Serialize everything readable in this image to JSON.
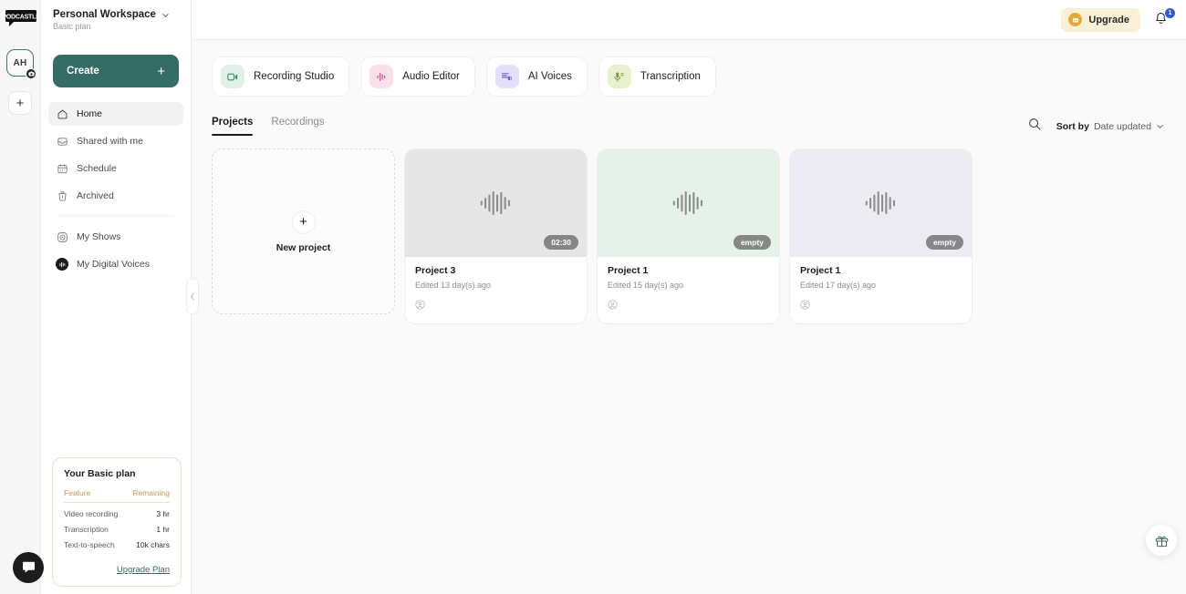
{
  "brand": {
    "logo_text": "PODCASTLE"
  },
  "rail": {
    "avatar_initials": "AH",
    "add_label": "+"
  },
  "workspace": {
    "name": "Personal Workspace",
    "plan": "Basic plan"
  },
  "sidebar": {
    "create_label": "Create",
    "create_plus": "+",
    "items": [
      {
        "label": "Home",
        "icon": "home-icon"
      },
      {
        "label": "Shared with me",
        "icon": "inbox-icon"
      },
      {
        "label": "Schedule",
        "icon": "calendar-icon"
      },
      {
        "label": "Archived",
        "icon": "trash-icon"
      }
    ],
    "secondary_items": [
      {
        "label": "My Shows",
        "icon": "shows-icon"
      },
      {
        "label": "My Digital Voices",
        "icon": "digital-voices-icon"
      }
    ],
    "collapse_icon": "chevron-left-icon"
  },
  "plan_card": {
    "title": "Your Basic plan",
    "col_feature": "Feature",
    "col_remaining": "Remaining",
    "rows": [
      {
        "feature": "Video recording",
        "remaining": "3 hr"
      },
      {
        "feature": "Transcription",
        "remaining": "1 hr"
      },
      {
        "feature": "Text-to-speech",
        "remaining": "10k chars"
      }
    ],
    "upgrade_link": "Upgrade Plan",
    "accent": "#356d64",
    "border": "#e9dfcd",
    "header_color": "#c69a55"
  },
  "topbar": {
    "upgrade_label": "Upgrade",
    "notification_count": "1",
    "badge_color": "#2f5bd8",
    "upgrade_bg": "#faf0d8"
  },
  "features": [
    {
      "label": "Recording Studio",
      "icon": "video-camera-icon",
      "tile_bg": "#dff0e6",
      "glyph": "#3f8f6b"
    },
    {
      "label": "Audio Editor",
      "icon": "audio-waveform-icon",
      "tile_bg": "#f9dfe9",
      "glyph": "#c45d8b"
    },
    {
      "label": "AI Voices",
      "icon": "ai-voices-icon",
      "tile_bg": "#e3e0f9",
      "glyph": "#6b5cc4"
    },
    {
      "label": "Transcription",
      "icon": "microphone-icon",
      "tile_bg": "#e7f0cf",
      "glyph": "#7a9540"
    }
  ],
  "tabs": [
    {
      "label": "Projects",
      "active": true
    },
    {
      "label": "Recordings",
      "active": false
    }
  ],
  "toolbar": {
    "search_icon": "search-icon",
    "sort_prefix": "Sort by",
    "sort_value": "Date updated",
    "chevron": "chevron-down-icon"
  },
  "new_project": {
    "label": "New project",
    "plus": "+"
  },
  "projects": [
    {
      "title": "Project 3",
      "edited": "Edited 13 day(s) ago",
      "badge": "02:30",
      "thumb_bg": "#e6e6e6",
      "wave": "#8d8d8d"
    },
    {
      "title": "Project 1",
      "edited": "Edited 15 day(s) ago",
      "badge": "empty",
      "thumb_bg": "#e6f2e9",
      "wave": "#8d8d8d"
    },
    {
      "title": "Project 1",
      "edited": "Edited 17 day(s) ago",
      "badge": "empty",
      "thumb_bg": "#ececf2",
      "wave": "#8d8d8d"
    }
  ],
  "floating": {
    "gift_icon": "gift-icon",
    "chat_icon": "chat-bubble-icon"
  }
}
